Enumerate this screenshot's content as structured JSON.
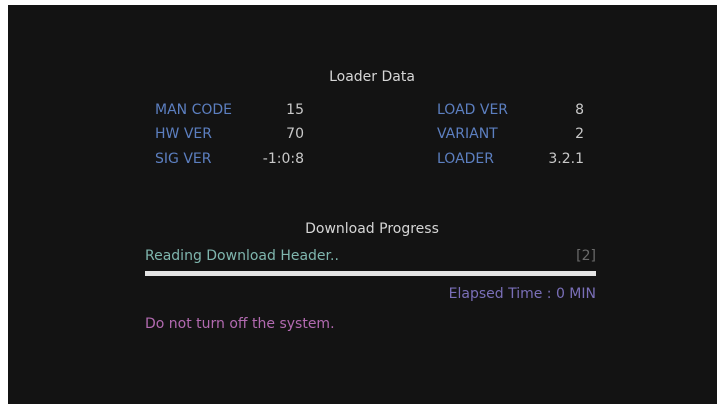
{
  "loader": {
    "title": "Loader Data",
    "rows": [
      {
        "label": "MAN CODE",
        "value": "15"
      },
      {
        "label": "HW VER",
        "value": "70"
      },
      {
        "label": "SIG VER",
        "value": "-1:0:8"
      },
      {
        "label": "LOAD VER",
        "value": "8"
      },
      {
        "label": "VARIANT",
        "value": "2"
      },
      {
        "label": "LOADER",
        "value": "3.2.1"
      }
    ]
  },
  "download": {
    "title": "Download Progress",
    "status": "Reading Download Header..",
    "count": "[2]",
    "progress": 1.0,
    "elapsed": "Elapsed Time : 0 MIN"
  },
  "warning": "Do not turn off the system.",
  "colors": {
    "background": "#131313",
    "label": "#5c7fc0",
    "value": "#c9c9c9",
    "status": "#7fb6ae",
    "elapsed": "#7a6fb8",
    "warning": "#b26ab0",
    "progress_fill": "#e4e4e4"
  }
}
